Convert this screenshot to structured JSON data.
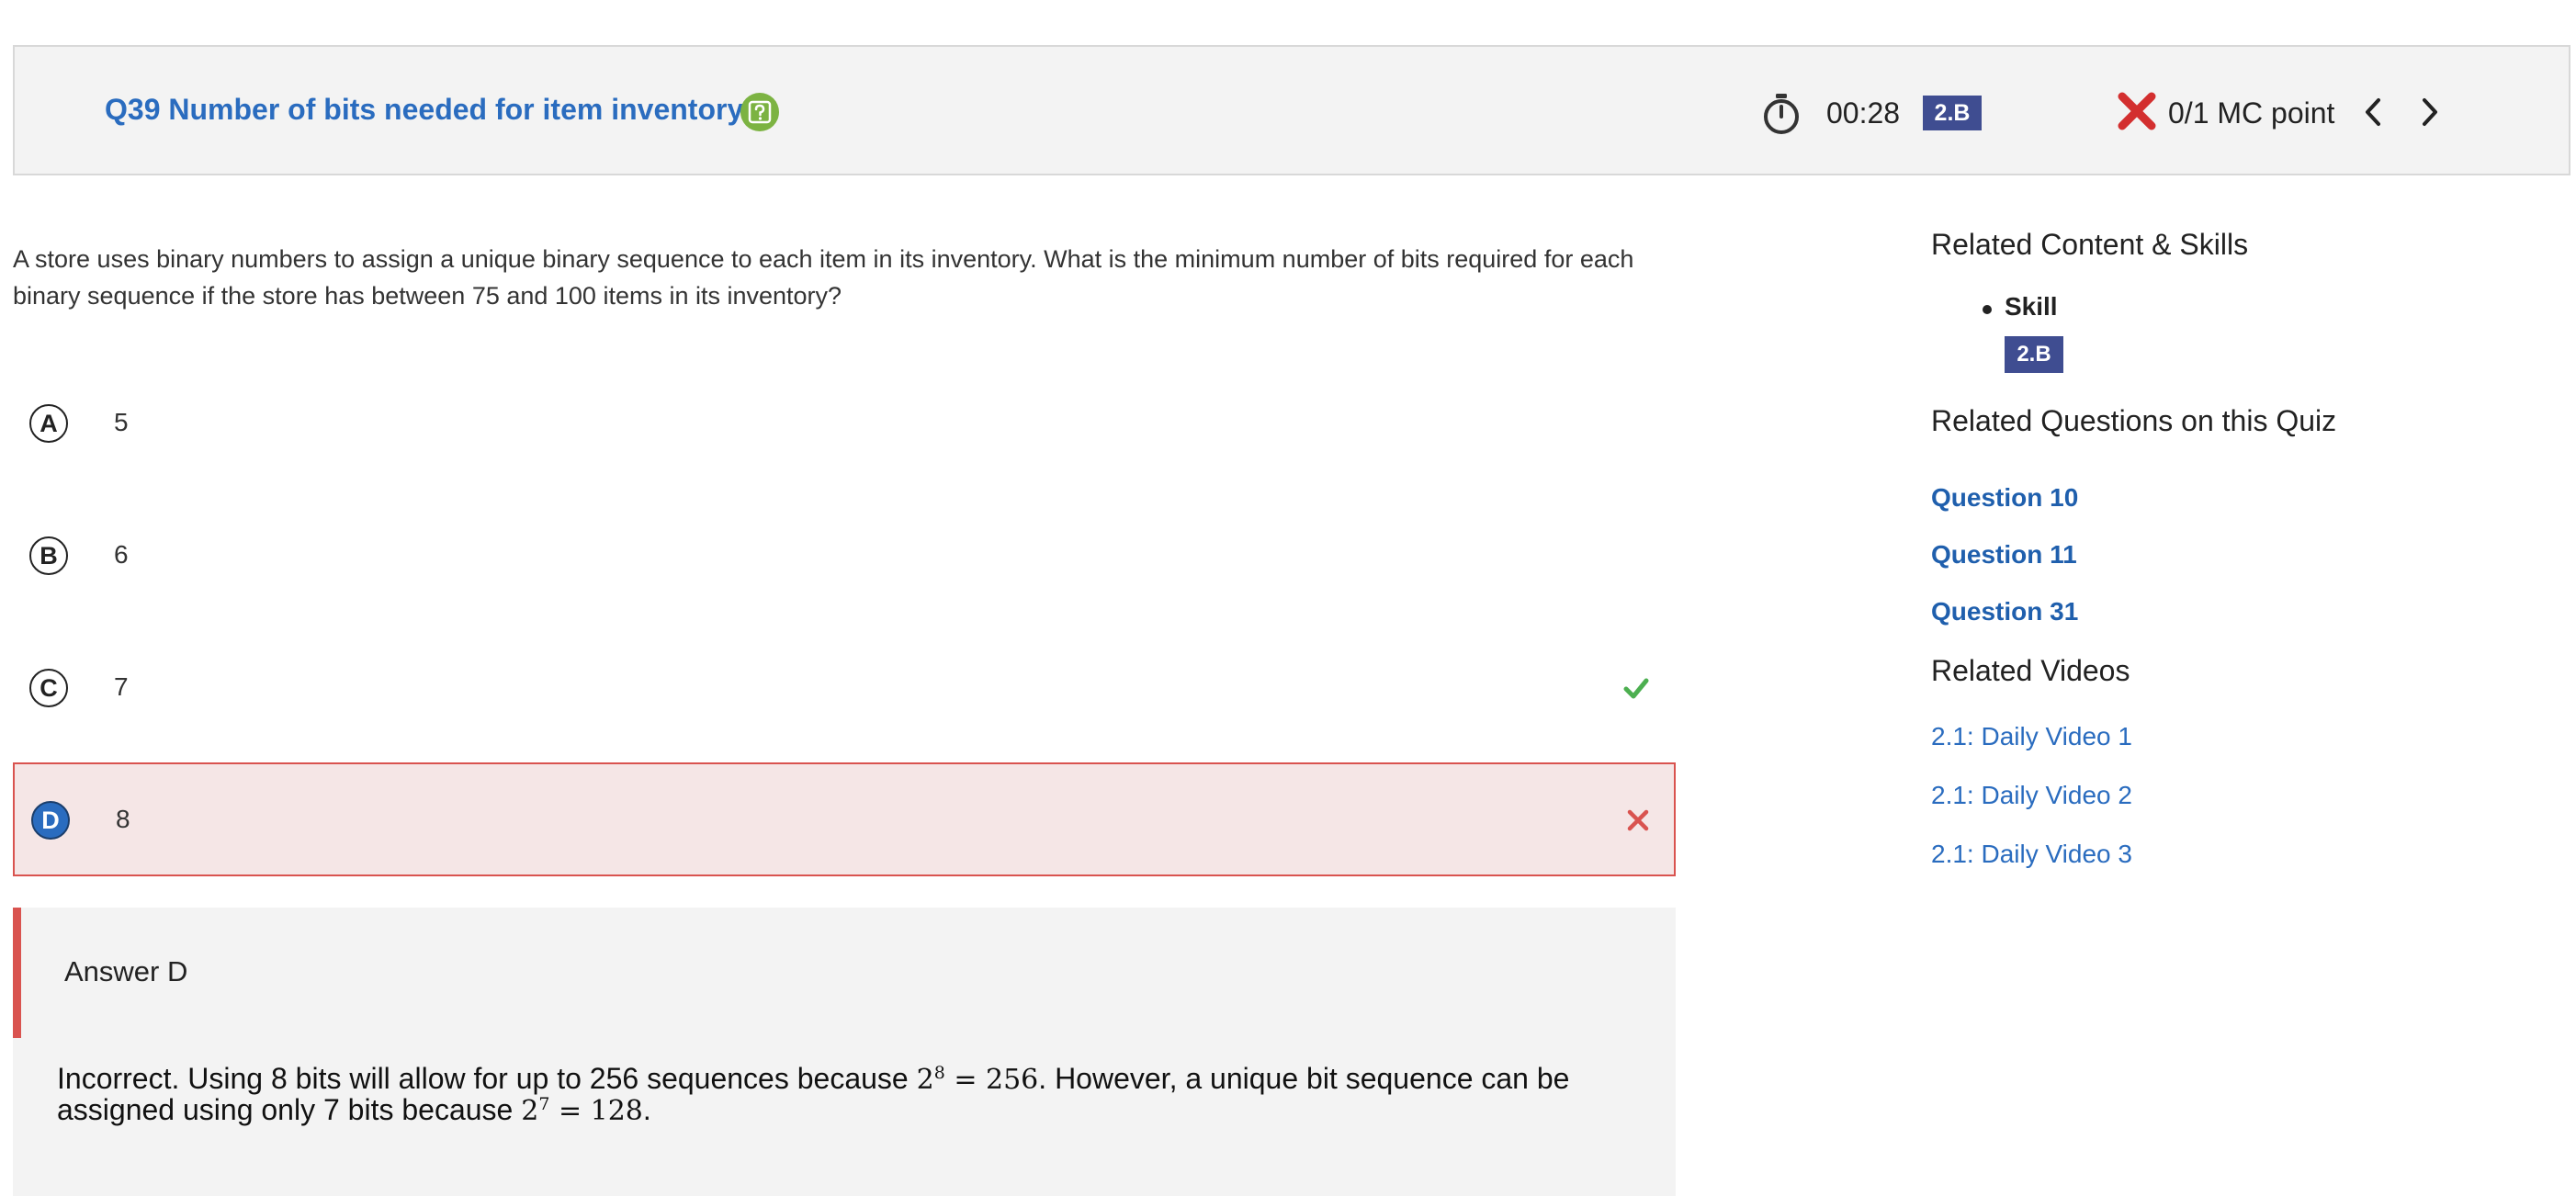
{
  "header": {
    "question_title": "Q39 Number of bits needed for item inventory",
    "help_icon": "help-question-icon",
    "timer": "00:28",
    "skill_badge": "2.B",
    "score": "0/1 MC point",
    "score_icon": "incorrect-x-icon"
  },
  "question": {
    "text": "A store uses binary numbers to assign a unique binary sequence to each item in its inventory. What is the minimum number of bits required for each binary sequence if the store has between 75 and 100 items in its inventory?",
    "options": [
      {
        "letter": "A",
        "text": "5"
      },
      {
        "letter": "B",
        "text": "6"
      },
      {
        "letter": "C",
        "text": "7",
        "status": "correct"
      },
      {
        "letter": "D",
        "text": "8",
        "status": "selected-incorrect"
      }
    ]
  },
  "answer": {
    "title": "Answer D",
    "expl_part1": "Incorrect. Using 8 bits will allow for up to 256 sequences because ",
    "math1_base": "2",
    "math1_exp": "8",
    "math1_rest": " = 256",
    "expl_part2": ". However, a unique bit sequence can be assigned using only 7 bits because ",
    "math2_base": "2",
    "math2_exp": "7",
    "math2_rest": " = 128",
    "expl_part3": "."
  },
  "sidebar": {
    "related_heading": "Related Content & Skills",
    "skill_label": "Skill",
    "skill_badge": "2.B",
    "related_questions_heading": "Related Questions on this Quiz",
    "related_questions": [
      "Question 10",
      "Question 11",
      "Question 31"
    ],
    "related_videos_heading": "Related Videos",
    "related_videos": [
      "2.1: Daily Video 1",
      "2.1: Daily Video 2",
      "2.1: Daily Video 3"
    ]
  },
  "colors": {
    "link_blue": "#2a6cbf",
    "badge_navy": "#3f4d91",
    "correct_green": "#4caf50",
    "incorrect_red": "#d9534f"
  }
}
